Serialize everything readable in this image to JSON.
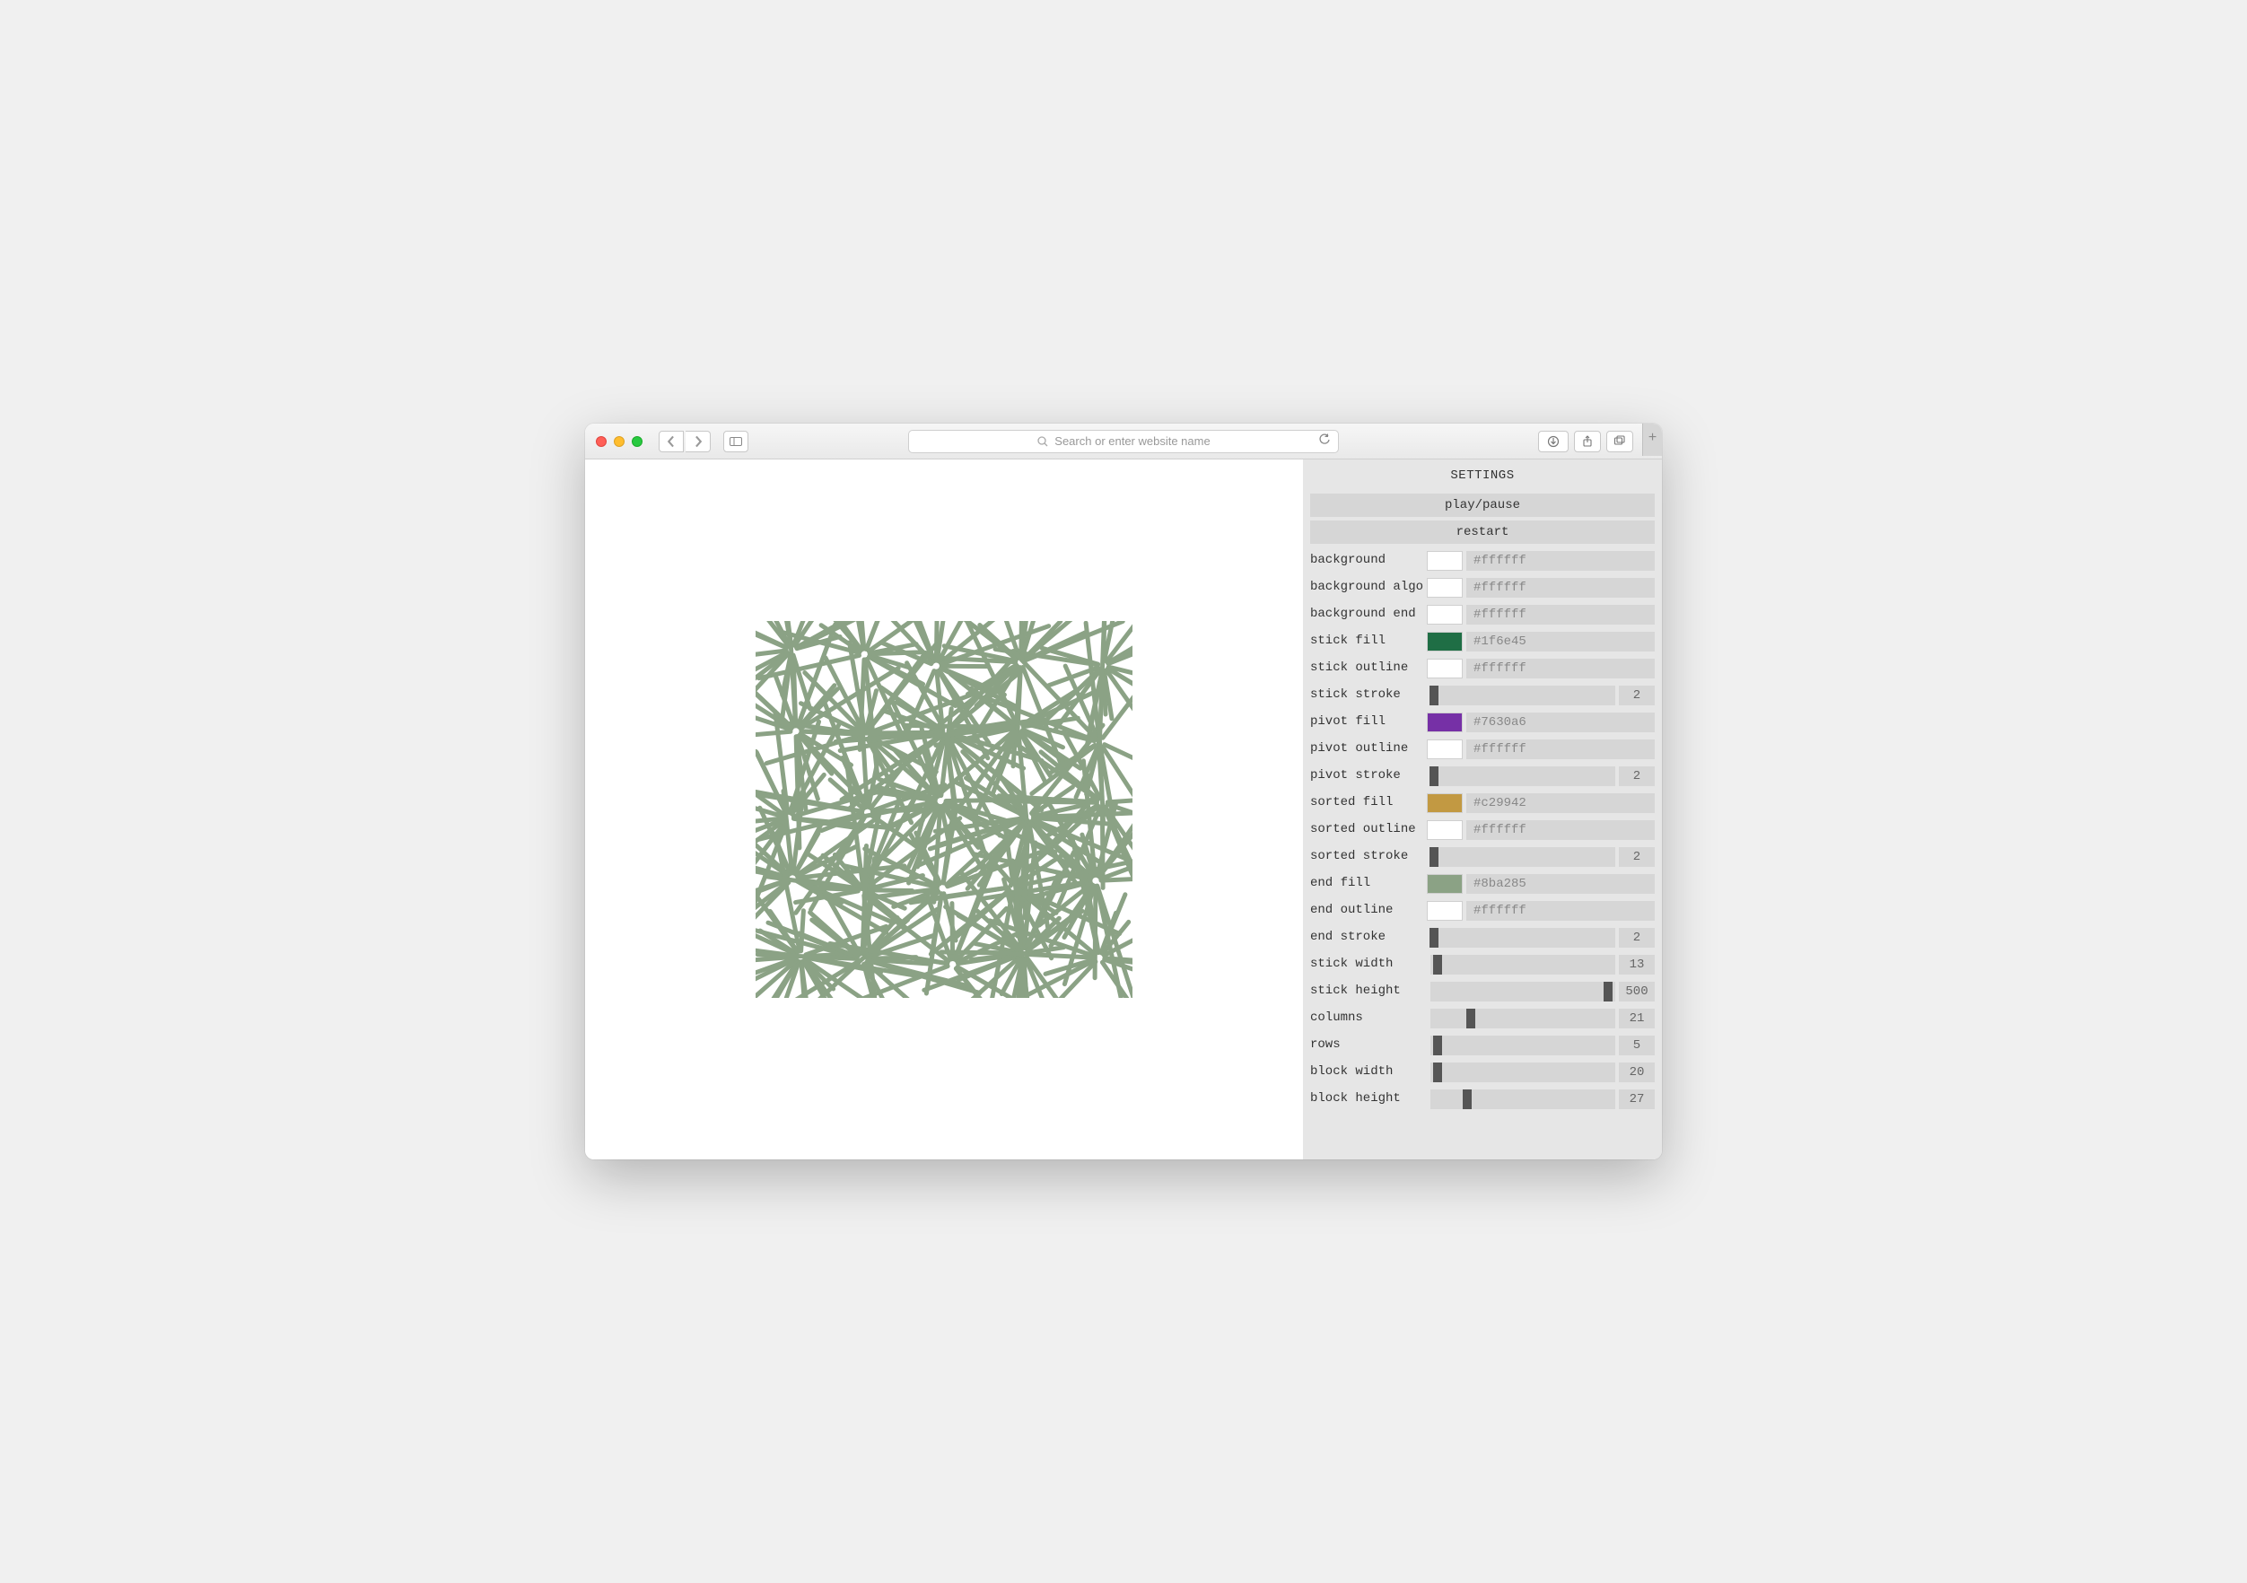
{
  "browser": {
    "address_placeholder": "Search or enter website name"
  },
  "panel": {
    "title": "SETTINGS",
    "play_pause": "play/pause",
    "restart": "restart",
    "rows": [
      {
        "type": "color",
        "label": "background",
        "swatch": "#ffffff",
        "value": "#ffffff"
      },
      {
        "type": "color",
        "label": "background algo",
        "swatch": "#ffffff",
        "value": "#ffffff"
      },
      {
        "type": "color",
        "label": "background end",
        "swatch": "#ffffff",
        "value": "#ffffff"
      },
      {
        "type": "color",
        "label": "stick fill",
        "swatch": "#1f6e45",
        "value": "#1f6e45"
      },
      {
        "type": "color",
        "label": "stick outline",
        "swatch": "#ffffff",
        "value": "#ffffff"
      },
      {
        "type": "slider",
        "label": "stick stroke",
        "value": 2,
        "pct": 2
      },
      {
        "type": "color",
        "label": "pivot fill",
        "swatch": "#7630a6",
        "value": "#7630a6"
      },
      {
        "type": "color",
        "label": "pivot outline",
        "swatch": "#ffffff",
        "value": "#ffffff"
      },
      {
        "type": "slider",
        "label": "pivot stroke",
        "value": 2,
        "pct": 2
      },
      {
        "type": "color",
        "label": "sorted fill",
        "swatch": "#c29942",
        "value": "#c29942"
      },
      {
        "type": "color",
        "label": "sorted outline",
        "swatch": "#ffffff",
        "value": "#ffffff"
      },
      {
        "type": "slider",
        "label": "sorted stroke",
        "value": 2,
        "pct": 2
      },
      {
        "type": "color",
        "label": "end fill",
        "swatch": "#8ba285",
        "value": "#8ba285"
      },
      {
        "type": "color",
        "label": "end outline",
        "swatch": "#ffffff",
        "value": "#ffffff"
      },
      {
        "type": "slider",
        "label": "end stroke",
        "value": 2,
        "pct": 2
      },
      {
        "type": "slider",
        "label": "stick width",
        "value": 13,
        "pct": 4
      },
      {
        "type": "slider",
        "label": "stick height",
        "value": 500,
        "pct": 96
      },
      {
        "type": "slider",
        "label": "columns",
        "value": 21,
        "pct": 22
      },
      {
        "type": "slider",
        "label": "rows",
        "value": 5,
        "pct": 4
      },
      {
        "type": "slider",
        "label": "block width",
        "value": 20,
        "pct": 4
      },
      {
        "type": "slider",
        "label": "block height",
        "value": 27,
        "pct": 20
      }
    ]
  }
}
